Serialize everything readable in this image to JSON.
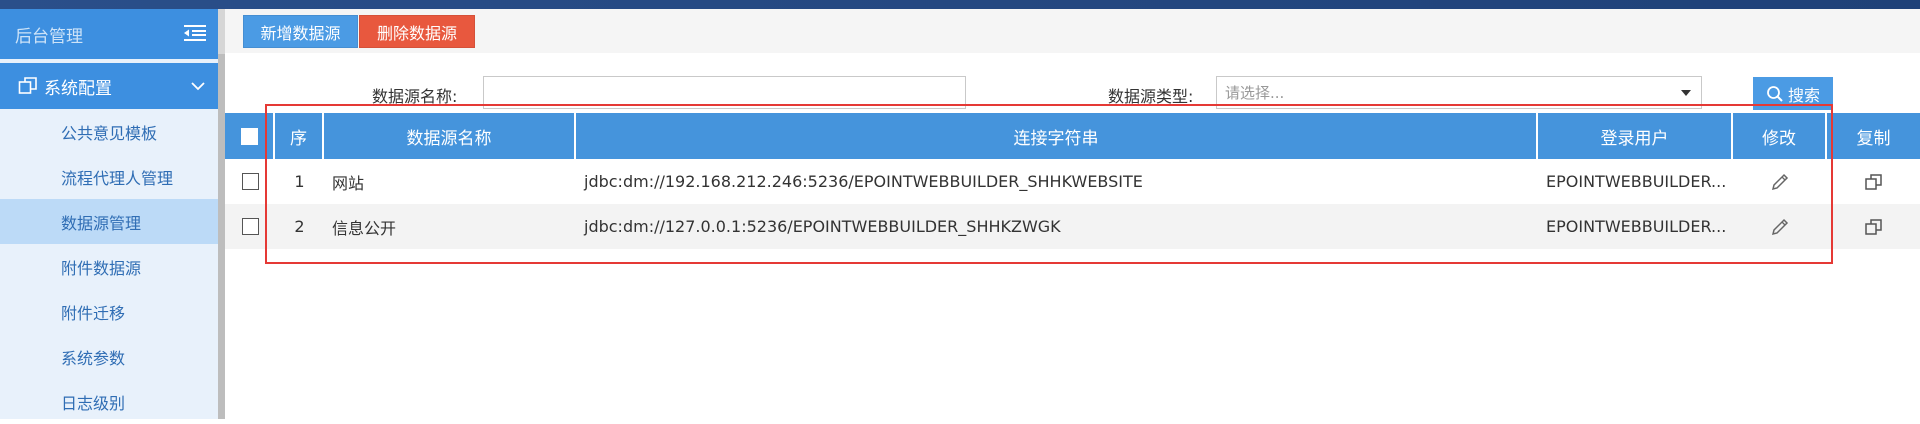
{
  "sidebar": {
    "title": "后台管理",
    "group_label": "系统配置",
    "items": [
      {
        "label": "公共意见模板"
      },
      {
        "label": "流程代理人管理"
      },
      {
        "label": "数据源管理"
      },
      {
        "label": "附件数据源"
      },
      {
        "label": "附件迁移"
      },
      {
        "label": "系统参数"
      },
      {
        "label": "日志级别"
      }
    ]
  },
  "toolbar": {
    "add_label": "新增数据源",
    "delete_label": "删除数据源"
  },
  "search": {
    "name_label": "数据源名称:",
    "name_value": "",
    "type_label": "数据源类型:",
    "type_placeholder": "请选择...",
    "search_label": "搜索"
  },
  "grid": {
    "headers": {
      "no": "序",
      "name": "数据源名称",
      "conn": "连接字符串",
      "user": "登录用户",
      "edit": "修改",
      "copy": "复制"
    },
    "rows": [
      {
        "no": "1",
        "name": "网站",
        "conn": "jdbc:dm://192.168.212.246:5236/EPOINTWEBBUILDER_SHHKWEBSITE",
        "user": "EPOINTWEBBUILDER..."
      },
      {
        "no": "2",
        "name": "信息公开",
        "conn": "jdbc:dm://127.0.0.1:5236/EPOINTWEBBUILDER_SHHKZWGK",
        "user": "EPOINTWEBBUILDER..."
      }
    ]
  },
  "colors": {
    "accent": "#4594dc",
    "danger": "#e8583e",
    "highlight": "#e53935",
    "sidebar_bg": "#e8f1fb"
  },
  "icons": {
    "menu": "menu-collapse-icon",
    "group": "window-icon",
    "chevron": "chevron-down-icon",
    "search": "search-icon",
    "edit": "pencil-icon",
    "copy": "copy-icon"
  }
}
